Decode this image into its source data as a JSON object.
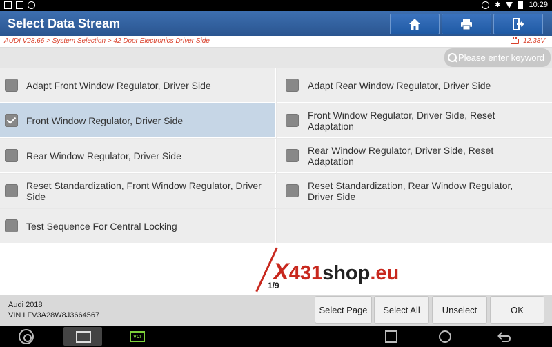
{
  "statusbar": {
    "time": "10:29"
  },
  "header": {
    "title": "Select Data Stream",
    "buttons": [
      "home",
      "print",
      "exit"
    ]
  },
  "breadcrumb": {
    "path": "AUDI V28.66 > System Selection > 42 Door Electronics Driver Side",
    "voltage": "12.38V"
  },
  "search": {
    "placeholder": "Please enter keyword"
  },
  "items": [
    {
      "label": "Adapt Front Window Regulator, Driver Side",
      "checked": false
    },
    {
      "label": "Adapt Rear Window Regulator, Driver Side",
      "checked": false
    },
    {
      "label": "Front Window Regulator, Driver Side",
      "checked": true
    },
    {
      "label": "Front Window Regulator, Driver Side, Reset Adaptation",
      "checked": false
    },
    {
      "label": "Rear Window Regulator, Driver Side",
      "checked": false
    },
    {
      "label": "Rear Window Regulator, Driver Side, Reset Adaptation",
      "checked": false
    },
    {
      "label": "Reset Standardization, Front Window Regulator, Driver Side",
      "checked": false
    },
    {
      "label": "Reset Standardization, Rear Window Regulator, Driver Side",
      "checked": false
    },
    {
      "label": "Test Sequence For Central Locking",
      "checked": false
    }
  ],
  "pagination": {
    "text": "1/9"
  },
  "watermark": {
    "x": "X",
    "num": "431",
    "shop": "shop",
    "eu": ".eu"
  },
  "vehicle": {
    "model": "Audi  2018",
    "vin": "VIN LFV3A28W8J3664567"
  },
  "actions": {
    "select_page": "Select Page",
    "select_all": "Select All",
    "unselect": "Unselect",
    "ok": "OK"
  },
  "navbar": {
    "vci_label": "VCI"
  }
}
